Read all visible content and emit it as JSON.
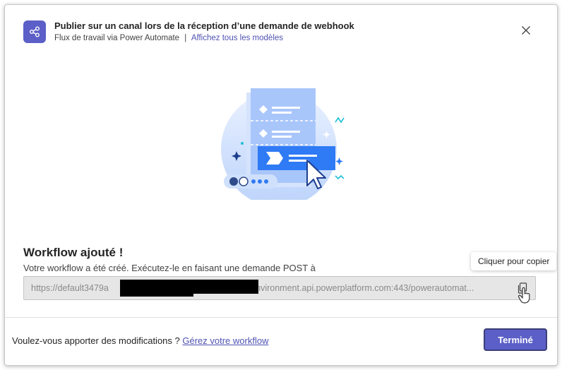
{
  "header": {
    "title": "Publier sur un canal lors de la réception d’une demande de webhook",
    "subtitle": "Flux de travail via Power Automate",
    "separator": "|",
    "templates_link": "Affichez tous les modèles",
    "app_icon": "share-icon",
    "close_icon": "close-icon"
  },
  "success": {
    "title": "Workflow ajouté !",
    "description": "Votre workflow a été créé. Exécutez-le en faisant une demande POST à"
  },
  "url": {
    "value_visible_start": "https://default3479a",
    "value_visible_end": "e1.environment.api.powerplatform.com:443/powerautomat...",
    "copy_icon": "copy-icon"
  },
  "tooltip": {
    "text": "Cliquer pour copier"
  },
  "footer": {
    "question": "Voulez-vous apporter des modifications ?",
    "manage_link": "Gérez votre workflow",
    "done_label": "Terminé"
  },
  "colors": {
    "brand": "#5b5fc7",
    "link": "#4f52b2",
    "illustration_blue": "#2f7af5"
  }
}
